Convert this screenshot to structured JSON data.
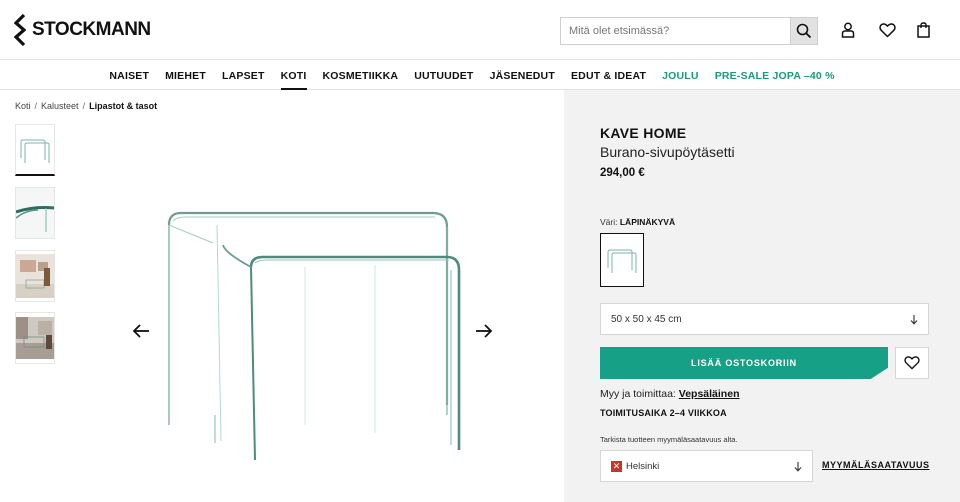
{
  "header": {
    "logo_text": "STOCKMANN",
    "search_placeholder": "Mitä olet etsimässä?"
  },
  "icons": {
    "search": "search-icon",
    "account": "user-icon",
    "wishlist": "heart-icon",
    "cart": "shopping-bag-icon",
    "prev": "arrow-left-icon",
    "next": "arrow-right-icon"
  },
  "nav": {
    "items": [
      {
        "label": "NAISET"
      },
      {
        "label": "MIEHET"
      },
      {
        "label": "LAPSET"
      },
      {
        "label": "KOTI"
      },
      {
        "label": "KOSMETIIKKA"
      },
      {
        "label": "UUTUUDET"
      },
      {
        "label": "JÄSENEDUT"
      },
      {
        "label": "EDUT & IDEAT"
      },
      {
        "label": "JOULU"
      },
      {
        "label": "PRE-SALE JOPA –40 %"
      }
    ],
    "active_label": "KOTI",
    "accent_color": "#1a9a7e"
  },
  "breadcrumb": {
    "items": [
      "Koti",
      "Kalusteet"
    ],
    "current": "Lipastot & tasot"
  },
  "product": {
    "brand": "KAVE HOME",
    "name": "Burano-sivupöytäsetti",
    "price": "294,00 €",
    "color_label": "Väri:",
    "color_value": "LÄPINÄKYVÄ",
    "size_value": "50 x 50 x 45 cm",
    "add_to_cart": "LISÄÄ OSTOSKORIIN",
    "button_color": "#16a085",
    "seller_label": "Myy ja toimittaa:",
    "seller_name": "Vepsäläinen",
    "delivery_time": "TOIMITUSAIKA 2–4 VIIKKOA",
    "store_note": "Tarkista tuotteen myymäläsaatavuus alta.",
    "store_value": "Helsinki",
    "store_flag": "✕",
    "availability_link": "MYYMÄLÄSAATAVUUS"
  }
}
